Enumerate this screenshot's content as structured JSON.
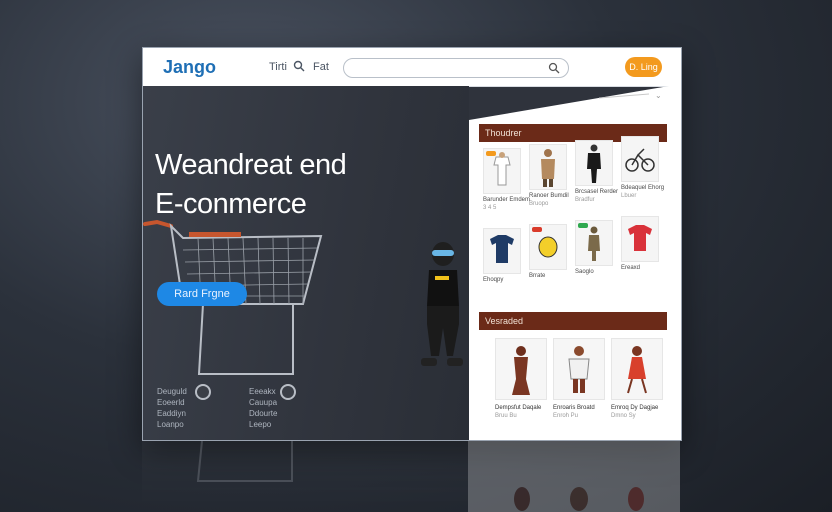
{
  "header": {
    "logo": "Jango",
    "nav": [
      "Tirti",
      "Fat"
    ],
    "search": {
      "placeholder": ""
    },
    "cta": "D. Ling"
  },
  "hero": {
    "title_line1": "Weandreat end",
    "title_line2": "E-conmerce",
    "button": "Rard Frgne",
    "footer_col1": [
      "Deuguld",
      "Eoeerld",
      "Eaddiyn",
      "Loanpo"
    ],
    "footer_col2": [
      "Eeeakx",
      "Cauupa",
      "Ddourte",
      "Leepo"
    ]
  },
  "panel": {
    "section1_title": "Thoudrer",
    "section2_title": "Vesraded",
    "grid_row1": [
      {
        "label": "Barunder Emdem",
        "sub": "3 4 5",
        "tag": "orange"
      },
      {
        "label": "Ranoer Bumdil",
        "sub": "Bruopo"
      },
      {
        "label": "Brcsasel Rerder",
        "sub": "Bradfur"
      },
      {
        "label": "Bdeaquel Ehorg",
        "sub": "Lbuer"
      }
    ],
    "grid_row2": [
      {
        "label": "Ehoqpy",
        "sub": ""
      },
      {
        "label": "Brrate",
        "sub": "",
        "tag": "red"
      },
      {
        "label": "Saoglo",
        "sub": "",
        "tag": "green"
      },
      {
        "label": "Ereaxd",
        "sub": ""
      }
    ],
    "featured": [
      {
        "label": "Dempsfut Daqale",
        "sub": "Bruu Bu"
      },
      {
        "label": "Enroaris Broatd",
        "sub": "Enroh Pu"
      },
      {
        "label": "Emroq Dy Dagjae",
        "sub": "Dmno Sy"
      }
    ]
  },
  "colors": {
    "accent_blue": "#1e88e5",
    "accent_orange": "#f39a1e",
    "section_brown": "#6b2a18",
    "logo_blue": "#1f6fb5"
  },
  "icons": [
    "search-icon",
    "shopping-cart",
    "avatar-figure"
  ]
}
